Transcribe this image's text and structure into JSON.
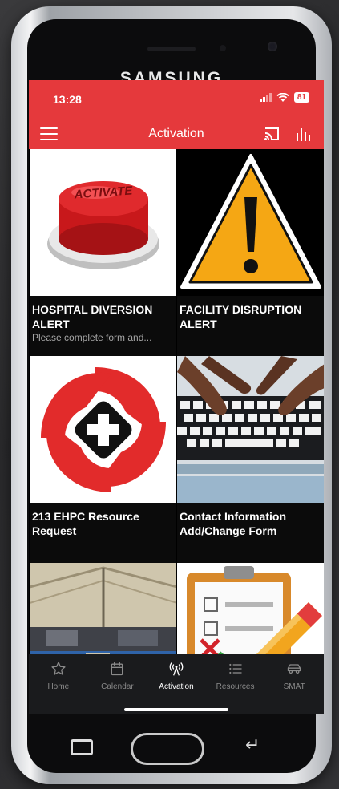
{
  "device": {
    "brand": "SAMSUNG"
  },
  "status_bar": {
    "time": "13:28",
    "battery": "81"
  },
  "app_bar": {
    "title": "Activation"
  },
  "tiles": [
    {
      "title": "HOSPITAL DIVERSION ALERT",
      "subtitle": "Please complete form and...",
      "image_text": "ACTIVATE"
    },
    {
      "title": "FACILITY DISRUPTION ALERT",
      "subtitle": ""
    },
    {
      "title": "213 EHPC Resource Request",
      "subtitle": ""
    },
    {
      "title": "Contact Information Add/Change Form",
      "subtitle": ""
    },
    {
      "title": "",
      "subtitle": ""
    },
    {
      "title": "",
      "subtitle": ""
    }
  ],
  "bottom_nav": {
    "items": [
      {
        "label": "Home",
        "icon": "star-icon"
      },
      {
        "label": "Calendar",
        "icon": "calendar-icon"
      },
      {
        "label": "Activation",
        "icon": "antenna-icon"
      },
      {
        "label": "Resources",
        "icon": "list-icon"
      },
      {
        "label": "SMAT",
        "icon": "car-icon"
      }
    ],
    "active": "Activation"
  },
  "colors": {
    "accent": "#e5393c",
    "nav_bg": "#1a1b1d",
    "tile_bg": "#0b0b0b"
  }
}
